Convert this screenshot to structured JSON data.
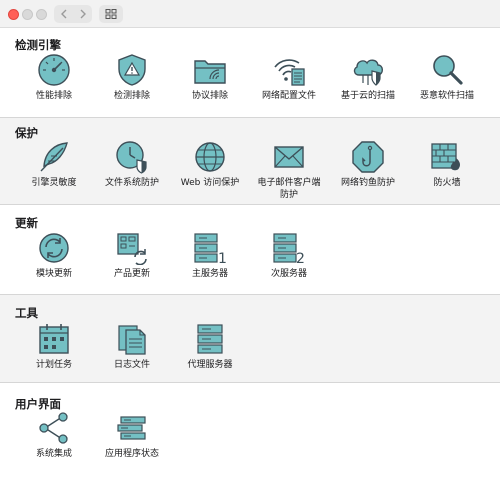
{
  "window": {
    "controls": [
      "close",
      "minimize",
      "zoom"
    ],
    "toolbar": [
      "back-icon",
      "forward-icon",
      "grid-view-icon"
    ]
  },
  "colors": {
    "icon_fill": "#74c0c4",
    "icon_stroke": "#3d4f58",
    "shaded_bg": "#f3f3f3"
  },
  "sections": {
    "detection": {
      "title": "检测引擎",
      "items": [
        {
          "label": "性能排除",
          "icon": "gauge-icon"
        },
        {
          "label": "检测排除",
          "icon": "shield-warning-icon"
        },
        {
          "label": "协议排除",
          "icon": "folder-signal-icon"
        },
        {
          "label": "网络配置文件",
          "icon": "wifi-document-icon"
        },
        {
          "label": "基于云的扫描",
          "icon": "cloud-shield-icon"
        },
        {
          "label": "恶意软件扫描",
          "icon": "magnifier-icon"
        }
      ]
    },
    "protection": {
      "title": "保护",
      "items": [
        {
          "label": "引擎灵敏度",
          "icon": "feather-icon"
        },
        {
          "label": "文件系统防护",
          "icon": "clock-shield-icon"
        },
        {
          "label": "Web 访问保护",
          "icon": "globe-icon"
        },
        {
          "label": "电子邮件客户端",
          "label2": "防护",
          "icon": "envelope-icon"
        },
        {
          "label": "网络钓鱼防护",
          "icon": "hook-icon"
        },
        {
          "label": "防火墙",
          "icon": "firewall-icon"
        }
      ]
    },
    "updates": {
      "title": "更新",
      "items": [
        {
          "label": "模块更新",
          "icon": "refresh-icon"
        },
        {
          "label": "产品更新",
          "icon": "app-update-icon"
        },
        {
          "label": "主服务器",
          "icon": "server-primary-icon",
          "badge": "1"
        },
        {
          "label": "次服务器",
          "icon": "server-secondary-icon",
          "badge": "2"
        }
      ]
    },
    "tools": {
      "title": "工具",
      "items": [
        {
          "label": "计划任务",
          "icon": "calendar-icon"
        },
        {
          "label": "日志文件",
          "icon": "documents-icon"
        },
        {
          "label": "代理服务器",
          "icon": "proxy-server-icon"
        }
      ]
    },
    "ui": {
      "title": "用户界面",
      "items": [
        {
          "label": "系统集成",
          "icon": "share-nodes-icon"
        },
        {
          "label": "应用程序状态",
          "icon": "status-bars-icon"
        }
      ]
    }
  }
}
